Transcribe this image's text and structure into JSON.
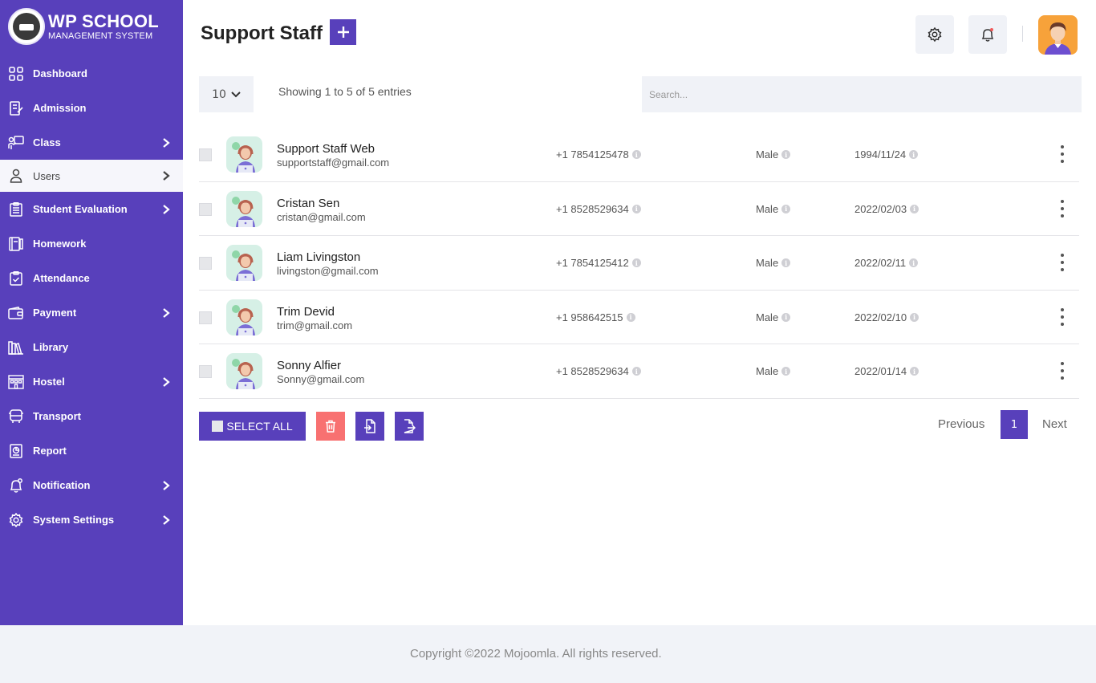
{
  "app": {
    "logo_title": "WP SCHOOL",
    "logo_subtitle": "MANAGEMENT SYSTEM",
    "accent_color": "#5840bb"
  },
  "sidebar": {
    "items": [
      {
        "label": "Dashboard",
        "icon": "dashboard-grid-icon",
        "has_submenu": false
      },
      {
        "label": "Admission",
        "icon": "admission-form-icon",
        "has_submenu": false
      },
      {
        "label": "Class",
        "icon": "class-board-icon",
        "has_submenu": true
      },
      {
        "label": "Users",
        "icon": "user-icon",
        "has_submenu": true,
        "active": true
      },
      {
        "label": "Student Evaluation",
        "icon": "evaluation-clipboard-icon",
        "has_submenu": true
      },
      {
        "label": "Homework",
        "icon": "homework-book-icon",
        "has_submenu": false
      },
      {
        "label": "Attendance",
        "icon": "attendance-check-icon",
        "has_submenu": false
      },
      {
        "label": "Payment",
        "icon": "wallet-icon",
        "has_submenu": true
      },
      {
        "label": "Library",
        "icon": "library-books-icon",
        "has_submenu": false
      },
      {
        "label": "Hostel",
        "icon": "hostel-building-icon",
        "has_submenu": true
      },
      {
        "label": "Transport",
        "icon": "bus-icon",
        "has_submenu": false
      },
      {
        "label": "Report",
        "icon": "report-icon",
        "has_submenu": false
      },
      {
        "label": "Notification",
        "icon": "notification-bell-icon",
        "has_submenu": true
      },
      {
        "label": "System Settings",
        "icon": "gear-icon",
        "has_submenu": true
      }
    ]
  },
  "header": {
    "title": "Support Staff",
    "add_icon": "plus-icon",
    "settings_icon": "gear-icon",
    "notification_icon": "bell-icon",
    "avatar_icon": "user-avatar-icon"
  },
  "table": {
    "page_length": "10",
    "info": "Showing 1 to 5 of 5 entries",
    "search_placeholder": "Search...",
    "rows": [
      {
        "name": "Support Staff Web",
        "email": "supportstaff@gmail.com",
        "phone": "+1 7854125478",
        "gender": "Male",
        "dob": "1994/11/24"
      },
      {
        "name": "Cristan Sen",
        "email": "cristan@gmail.com",
        "phone": "+1 8528529634",
        "gender": "Male",
        "dob": "2022/02/03"
      },
      {
        "name": "Liam Livingston",
        "email": "livingston@gmail.com",
        "phone": "+1 7854125412",
        "gender": "Male",
        "dob": "2022/02/11"
      },
      {
        "name": "Trim Devid",
        "email": "trim@gmail.com",
        "phone": "+1 958642515",
        "gender": "Male",
        "dob": "2022/02/10"
      },
      {
        "name": "Sonny Alfier",
        "email": "Sonny@gmail.com",
        "phone": "+1 8528529634",
        "gender": "Male",
        "dob": "2022/01/14"
      }
    ]
  },
  "actions": {
    "select_all": "SELECT ALL",
    "delete_icon": "trash-icon",
    "import_icon": "import-file-icon",
    "export_icon": "export-file-icon",
    "delete_color": "#f87171"
  },
  "pagination": {
    "previous": "Previous",
    "current": "1",
    "next": "Next"
  },
  "footer": {
    "copyright": "Copyright ©2022 Mojoomla. All rights reserved."
  }
}
